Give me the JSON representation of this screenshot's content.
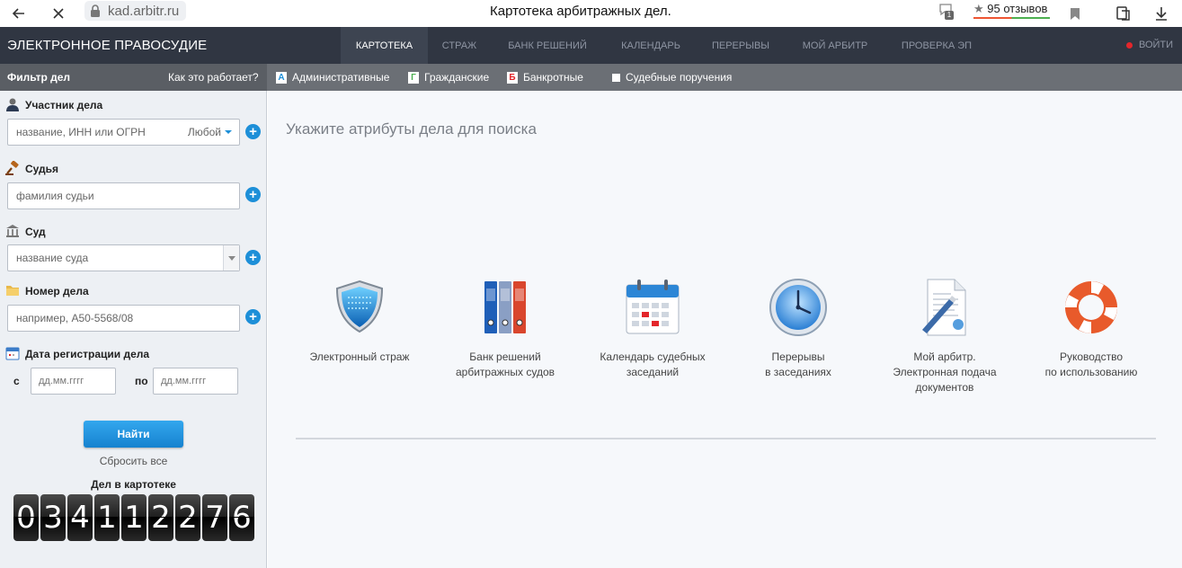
{
  "browser": {
    "url": "kad.arbitr.ru",
    "tab_title": "Картотека арбитражных дел.",
    "badge_count": "1",
    "reviews": "95 отзывов"
  },
  "header": {
    "brand": "ЭЛЕКТРОННОЕ ПРАВОСУДИЕ",
    "menu": [
      {
        "label": "КАРТОТЕКА"
      },
      {
        "label": "СТРАЖ"
      },
      {
        "label": "БАНК РЕШЕНИЙ"
      },
      {
        "label": "КАЛЕНДАРЬ"
      },
      {
        "label": "ПЕРЕРЫВЫ"
      },
      {
        "label": "МОЙ АРБИТР"
      },
      {
        "label": "ПРОВЕРКА ЭП"
      }
    ],
    "login": "ВОЙТИ"
  },
  "filterbar": {
    "title": "Фильтр дел",
    "how_it_works": "Как это работает?",
    "types": [
      {
        "letter": "А",
        "label": "Административные",
        "color": "#1d8fd8"
      },
      {
        "letter": "Г",
        "label": "Гражданские",
        "color": "#4caf50"
      },
      {
        "letter": "Б",
        "label": "Банкротные",
        "color": "#e3262b"
      },
      {
        "letter": "",
        "label": "Судебные поручения",
        "color": "#ffffff"
      }
    ]
  },
  "sidebar": {
    "participant": {
      "label": "Участник дела",
      "placeholder": "название, ИНН или ОГРН",
      "role": "Любой"
    },
    "judge": {
      "label": "Судья",
      "placeholder": "фамилия судьи"
    },
    "court": {
      "label": "Суд",
      "placeholder": "название суда"
    },
    "case_number": {
      "label": "Номер дела",
      "placeholder": "например, А50-5568/08"
    },
    "reg_date": {
      "label": "Дата регистрации дела",
      "from": "с",
      "to": "по",
      "placeholder": "дд.мм.гггг"
    },
    "find_button": "Найти",
    "reset": "Сбросить все",
    "counter_title": "Дел в картотеке",
    "counter_digits": [
      "0",
      "3",
      "4",
      "1",
      "1",
      "2",
      "2",
      "7",
      "6"
    ]
  },
  "main": {
    "title": "Укажите атрибуты дела для поиска",
    "services": [
      {
        "icon": "shield-icon",
        "label": "Электронный страж"
      },
      {
        "icon": "binders-icon",
        "label": "Банк решений\nарбитражных судов"
      },
      {
        "icon": "calendar-icon",
        "label": "Календарь судебных\nзаседаний"
      },
      {
        "icon": "clock-icon",
        "label": "Перерывы\nв заседаниях"
      },
      {
        "icon": "document-pen-icon",
        "label": "Мой арбитр.\nЭлектронная подача\nдокументов"
      },
      {
        "icon": "lifebuoy-icon",
        "label": "Руководство\nпо использованию"
      }
    ]
  },
  "colors": {
    "accent": "#1d8fd8",
    "nav_bg": "#303642",
    "filter_bg": "#6b6f75",
    "sidebar_bg": "#edf0f4"
  }
}
